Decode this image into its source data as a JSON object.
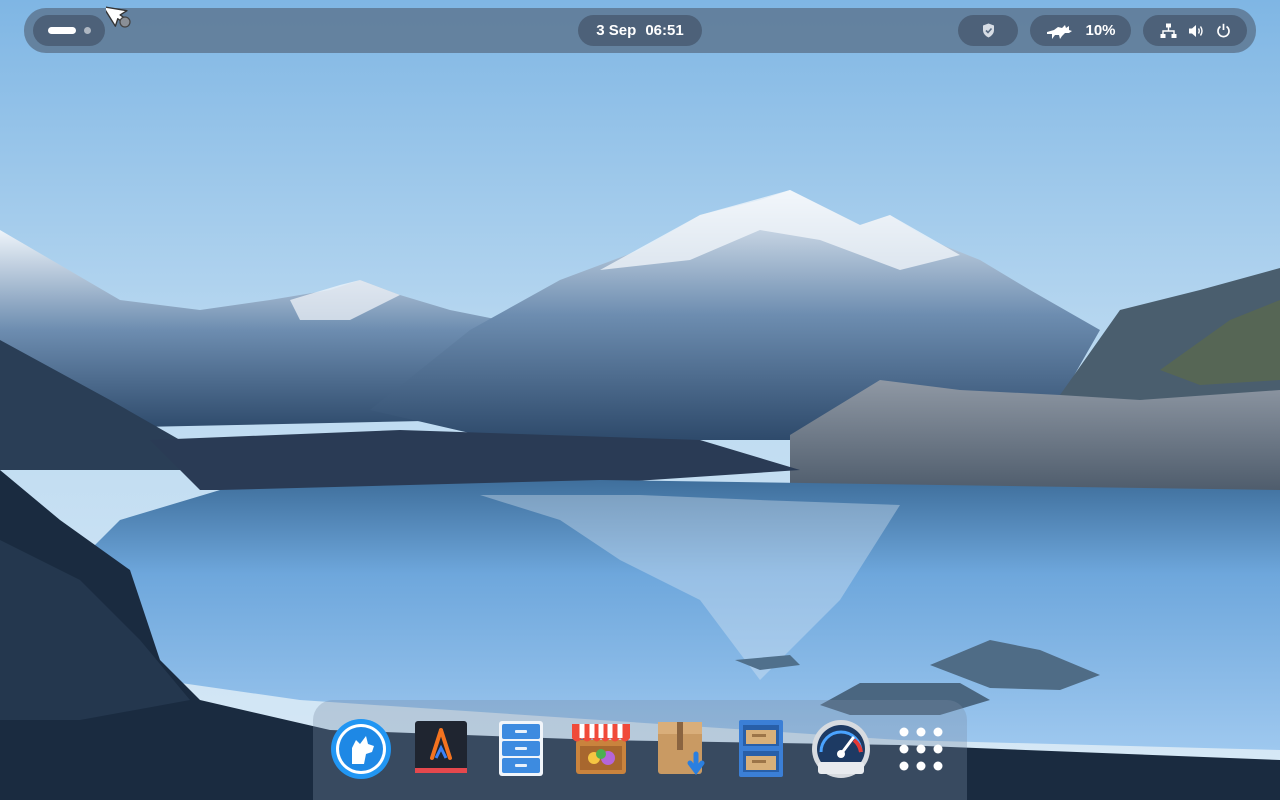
{
  "top_panel": {
    "clock": {
      "date": "3 Sep",
      "time": "06:51"
    },
    "battery": {
      "percent_label": "10%",
      "icon": "fox-icon"
    },
    "icons": [
      "shield-icon",
      "network-icon",
      "volume-icon",
      "power-icon"
    ],
    "workspaces": {
      "count": 2,
      "active_index": 0
    }
  },
  "dock": {
    "apps": [
      {
        "name": "browser",
        "icon": "wolf-browser-icon"
      },
      {
        "name": "code",
        "icon": "code-editor-icon"
      },
      {
        "name": "files",
        "icon": "file-cabinet-icon"
      },
      {
        "name": "app-store",
        "icon": "store-icon"
      },
      {
        "name": "installer",
        "icon": "package-installer-icon"
      },
      {
        "name": "archive",
        "icon": "archive-shelf-icon"
      },
      {
        "name": "system-monitor",
        "icon": "speedometer-icon"
      },
      {
        "name": "app-grid",
        "icon": "app-grid-icon"
      }
    ]
  },
  "colors": {
    "panel": "#586c84",
    "sky_top": "#7fb6e4",
    "water": "#5fa2dc",
    "accent_blue": "#1e88e5"
  }
}
